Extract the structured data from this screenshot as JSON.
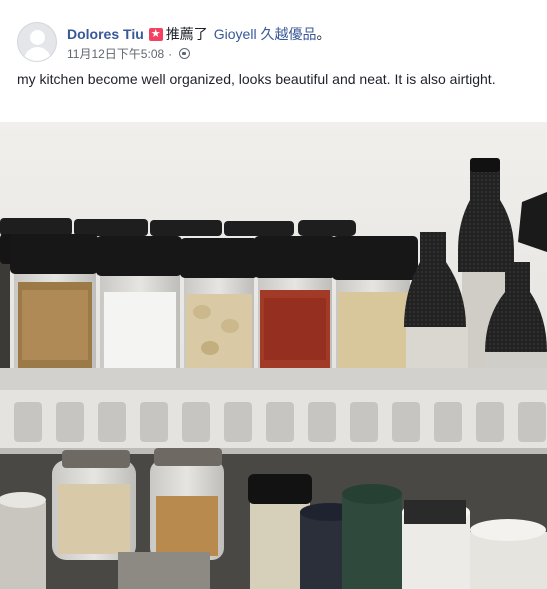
{
  "post": {
    "author": "Dolores Tiu",
    "action_text": "推薦了",
    "page_name": "Gioyell 久越優品",
    "punctuation": "。",
    "timestamp": "11月12日下午5:08",
    "separator": "·",
    "body": "my kitchen become well organized, looks beautiful and neat. It is also airtight.",
    "icons": [
      "avatar-placeholder",
      "recommend-star-icon",
      "globe-icon"
    ]
  },
  "photo": {
    "colors": {
      "wall": "#e9e7e2",
      "shelf": "#dcdbd8",
      "lid": "#1b1b1b"
    }
  }
}
